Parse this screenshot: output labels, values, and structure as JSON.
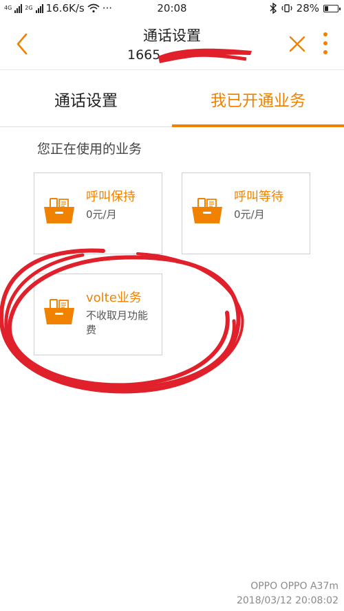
{
  "status_bar": {
    "network_left": "4G",
    "network_right": "2G",
    "speed": "16.6K/s",
    "dots": "···",
    "time": "20:08",
    "battery": "28%"
  },
  "header": {
    "title": "通话设置",
    "phone_visible": "1665"
  },
  "tabs": [
    {
      "label": "通话设置",
      "active": false
    },
    {
      "label": "我已开通业务",
      "active": true
    }
  ],
  "section_title": "您正在使用的业务",
  "services": [
    {
      "name": "呼叫保持",
      "price": "0元/月"
    },
    {
      "name": "呼叫等待",
      "price": "0元/月"
    },
    {
      "name": "volte业务",
      "price": "不收取月功能费"
    }
  ],
  "watermark": {
    "device": "OPPO OPPO A37m",
    "datetime": "2018/03/12 20:08:02"
  },
  "colors": {
    "accent": "#f08200",
    "annotation": "#e0202a"
  }
}
